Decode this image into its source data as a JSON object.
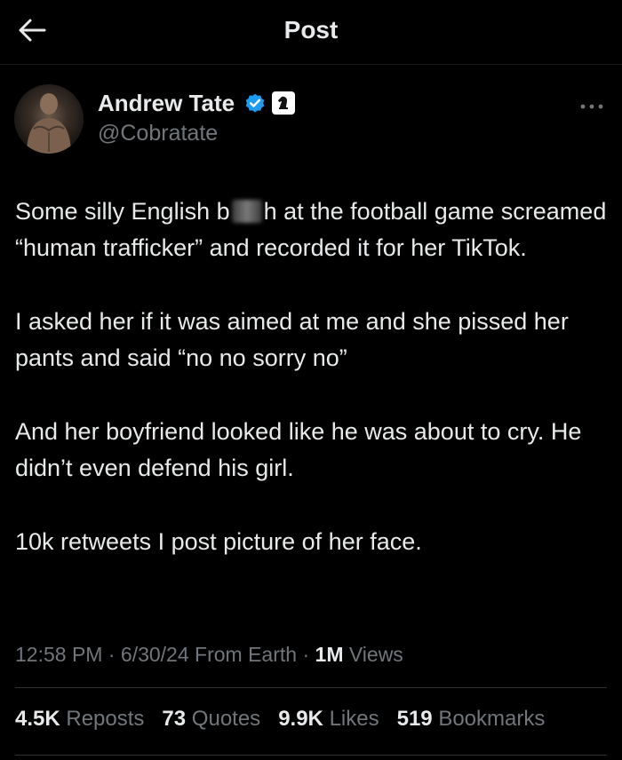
{
  "header": {
    "title": "Post",
    "back_icon": "arrow-left-icon"
  },
  "author": {
    "name": "Andrew Tate",
    "handle": "@Cobratate",
    "verified_color": "#1d9bf0"
  },
  "tweet": {
    "p1_before": "Some silly English b",
    "p1_after": "h at the football game screamed “human trafficker” and recorded it for her TikTok.",
    "p2": "I asked her if it was aimed at me and she pissed her pants and said “no no sorry no”",
    "p3": "And her boyfriend looked like he was about to cry. He didn’t even defend his girl.",
    "p4": "10k retweets I post picture of her face."
  },
  "meta": {
    "time": "12:58 PM",
    "sep1": " · ",
    "date": "6/30/24",
    "source": " From Earth",
    "sep2": " · ",
    "views_count": "1M",
    "views_label": " Views"
  },
  "stats": {
    "reposts_count": "4.5K",
    "reposts_label": "Reposts",
    "quotes_count": "73",
    "quotes_label": "Quotes",
    "likes_count": "9.9K",
    "likes_label": "Likes",
    "bookmarks_count": "519",
    "bookmarks_label": "Bookmarks"
  }
}
